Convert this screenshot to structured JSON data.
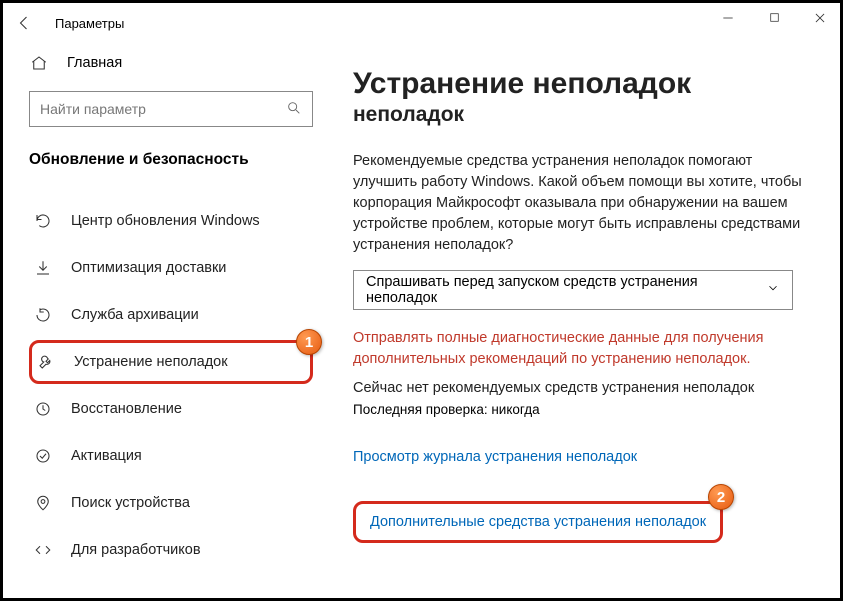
{
  "titlebar": {
    "title": "Параметры"
  },
  "sidebar": {
    "home_label": "Главная",
    "search_placeholder": "Найти параметр",
    "section_label": "Обновление и безопасность",
    "items": [
      {
        "label": "Центр обновления Windows"
      },
      {
        "label": "Оптимизация доставки"
      },
      {
        "label": "Служба архивации"
      },
      {
        "label": "Устранение неполадок"
      },
      {
        "label": "Восстановление"
      },
      {
        "label": "Активация"
      },
      {
        "label": "Поиск устройства"
      },
      {
        "label": "Для разработчиков"
      }
    ]
  },
  "content": {
    "heading": "Устранение неполадок",
    "subheading": "неполадок",
    "intro": "Рекомендуемые средства устранения неполадок помогают улучшить работу Windows. Какой объем помощи вы хотите, чтобы корпорация Майкрософт оказывала при обнаружении на вашем устройстве проблем, которые могут быть исправлены средствами устранения неполадок?",
    "dropdown": "Спрашивать перед запуском средств устранения неполадок",
    "warn": "Отправлять полные диагностические данные для получения дополнительных рекомендаций по устранению неполадок.",
    "none": "Сейчас нет рекомендуемых средств устранения неполадок",
    "lastcheck": "Последняя проверка: никогда",
    "link_history": "Просмотр журнала устранения неполадок",
    "link_more": "Дополнительные средства устранения неполадок"
  },
  "callouts": {
    "one": "1",
    "two": "2"
  }
}
